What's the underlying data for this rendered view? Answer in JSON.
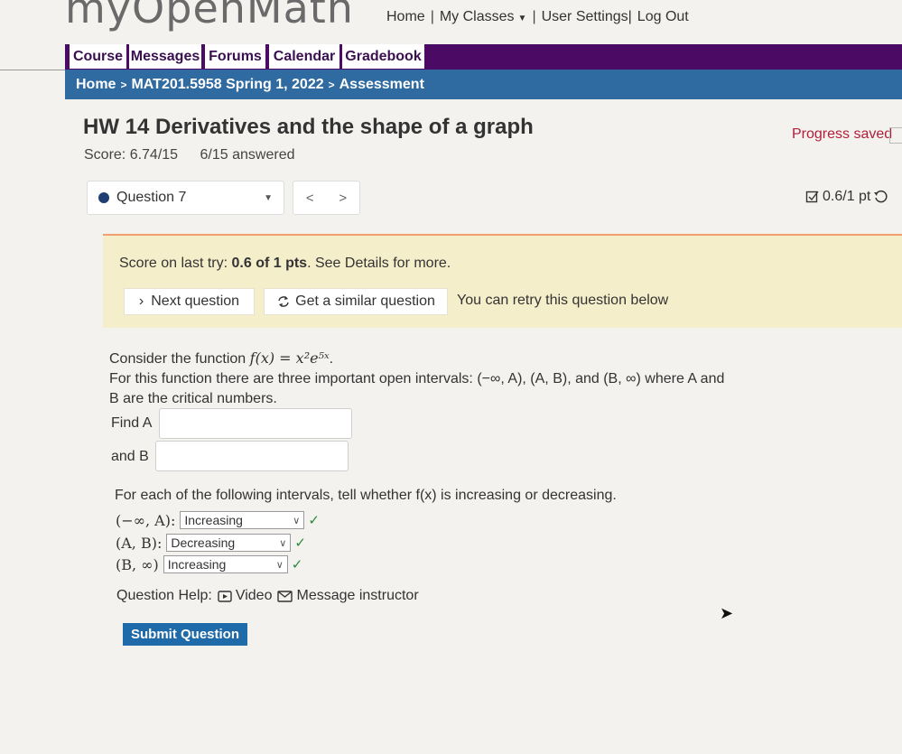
{
  "app": {
    "logo_text": "myOpenMath"
  },
  "topnav": {
    "home": "Home",
    "sep1": "|",
    "my_classes": "My Classes",
    "sep2": "|",
    "user_settings": "User Settings|",
    "log_out": "Log Out"
  },
  "menu": {
    "course": "Course",
    "messages": "Messages",
    "forums": "Forums",
    "calendar": "Calendar",
    "gradebook": "Gradebook"
  },
  "breadcrumb": {
    "home": "Home",
    "course": "MAT201.5958 Spring 1, 2022",
    "assessment": "Assessment",
    "sep": ">"
  },
  "assessment": {
    "title": "HW 14 Derivatives and the shape of a graph",
    "score_label": "Score: 6.74/15",
    "answered_label": "6/15 answered",
    "progress_saved": "Progress saved"
  },
  "question_nav": {
    "selected": "Question 7",
    "prev": "<",
    "next": ">",
    "points": "0.6/1 pt"
  },
  "feedback": {
    "prefix": "Score on last try: ",
    "score": "0.6 of 1 pts",
    "suffix": ". See Details for more.",
    "next_question": "Next question",
    "similar_question": "Get a similar question",
    "retry_note": "You can retry this question below"
  },
  "question": {
    "line1_prefix": "Consider the function ",
    "function": "f(x) = x²e⁵ˣ",
    "line1_suffix": ".",
    "line2": "For this function there are three important open intervals: (−∞, A), (A, B), and (B, ∞) where A and",
    "line3": "B are the critical numbers.",
    "find_a": "Find A",
    "and_b": "and B",
    "find_a_value": "",
    "and_b_value": ""
  },
  "intervals": {
    "prompt": "For each of the following intervals, tell whether f(x) is increasing or decreasing.",
    "rows": [
      {
        "label": "(−∞, A):",
        "value": "Increasing",
        "correct": true
      },
      {
        "label": "(A, B):",
        "value": "Decreasing",
        "correct": true
      },
      {
        "label": "(B, ∞)",
        "value": "Increasing",
        "correct": true
      }
    ],
    "check_mark": "✓",
    "chevron": "∨"
  },
  "help": {
    "label": "Question Help:",
    "video": "Video",
    "message": "Message instructor"
  },
  "submit": {
    "label": "Submit Question"
  },
  "colors": {
    "purple_bar": "#4b0a63",
    "blue_bar": "#2f6aa0",
    "progress_saved": "#b21e3a",
    "feedback_bg": "#f5eecb",
    "submit_bg": "#1f6aa8",
    "check": "#2a8a3a"
  }
}
